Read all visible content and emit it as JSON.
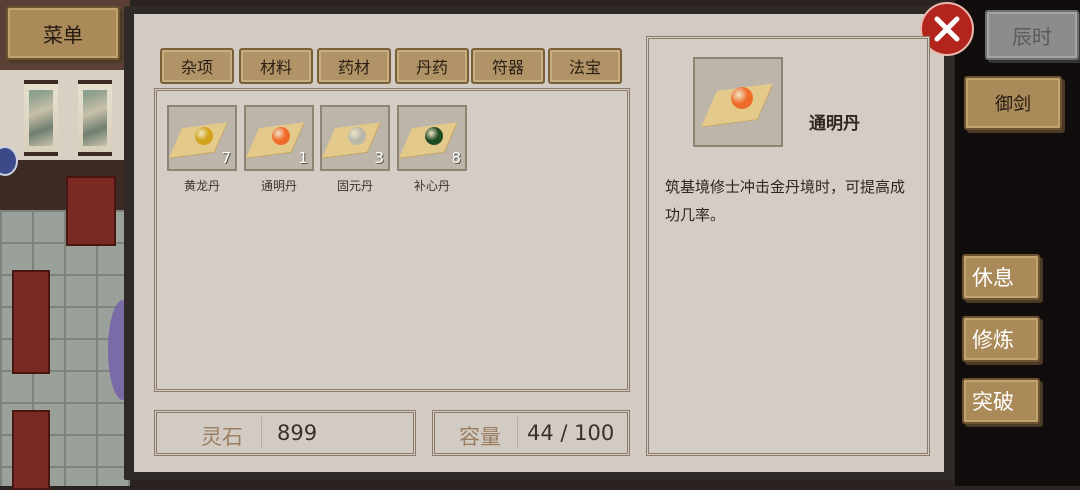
{
  "hud": {
    "menu_label": "菜单",
    "time_label": "辰时",
    "sword_label": "御剑",
    "actions": [
      {
        "label": "休息"
      },
      {
        "label": "修炼"
      },
      {
        "label": "突破"
      }
    ]
  },
  "inventory": {
    "tabs": [
      {
        "label": "杂项"
      },
      {
        "label": "材料"
      },
      {
        "label": "药材"
      },
      {
        "label": "丹药"
      },
      {
        "label": "符器"
      },
      {
        "label": "法宝"
      }
    ],
    "items": [
      {
        "name": "黄龙丹",
        "count": "7",
        "color": "#d1a21a"
      },
      {
        "name": "通明丹",
        "count": "1",
        "color": "#f06a2a"
      },
      {
        "name": "固元丹",
        "count": "3",
        "color": "#b8b8a8"
      },
      {
        "name": "补心丹",
        "count": "8",
        "color": "#1e4a22"
      }
    ],
    "spirit_stone": {
      "label": "灵石",
      "value": "899"
    },
    "capacity": {
      "label": "容量",
      "value": "44 / 100"
    }
  },
  "detail": {
    "name": "通明丹",
    "color": "#f06a2a",
    "description": "筑基境修士冲击金丹境时，可提高成功几率。"
  },
  "colors": {
    "close": "#b3251c",
    "panel": "#d2cbc3",
    "wood": "#a98a58"
  }
}
